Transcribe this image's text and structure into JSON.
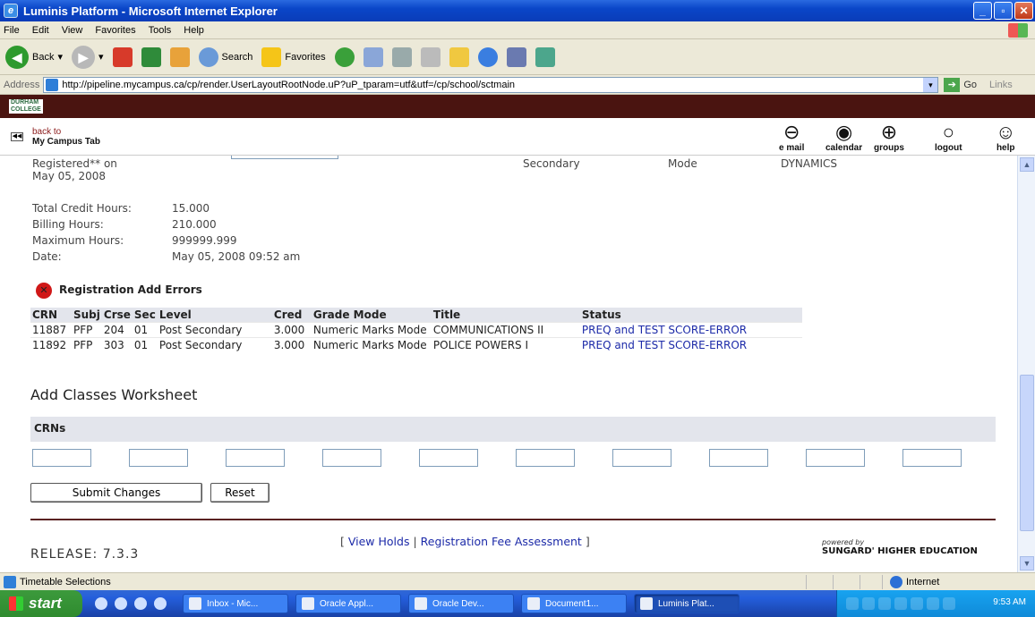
{
  "window": {
    "title": "Luminis Platform - Microsoft Internet Explorer"
  },
  "menu": [
    "File",
    "Edit",
    "View",
    "Favorites",
    "Tools",
    "Help"
  ],
  "toolbar": {
    "back": "Back",
    "search": "Search",
    "favorites": "Favorites"
  },
  "address": {
    "label": "Address",
    "url": "http://pipeline.mycampus.ca/cp/render.UserLayoutRootNode.uP?uP_tparam=utf&utf=/cp/school/sctmain",
    "go": "Go",
    "links": "Links"
  },
  "banner": {
    "logo_line1": "DURHAM",
    "logo_line2": "COLLEGE"
  },
  "nav": {
    "back_line1": "back to",
    "back_line2": "My Campus Tab",
    "icons": [
      {
        "label": "e mail",
        "glyph": "⊖"
      },
      {
        "label": "calendar",
        "glyph": "◉"
      },
      {
        "label": "groups",
        "glyph": "⊕"
      },
      {
        "label": "logout",
        "glyph": "○"
      },
      {
        "label": "help",
        "glyph": "☺"
      }
    ]
  },
  "top": {
    "registered": "Registered** on",
    "registered_date": "May 05, 2008",
    "secondary": "Secondary",
    "mode": "Mode",
    "dynamics": "DYNAMICS"
  },
  "summary": [
    {
      "label": "Total Credit Hours:",
      "value": "15.000"
    },
    {
      "label": "Billing Hours:",
      "value": "210.000"
    },
    {
      "label": "Maximum Hours:",
      "value": "999999.999"
    },
    {
      "label": "Date:",
      "value": "May 05, 2008 09:52 am"
    }
  ],
  "errors": {
    "heading": "Registration Add Errors",
    "columns": [
      "CRN",
      "Subj",
      "Crse",
      "Sec",
      "Level",
      "Cred",
      "Grade Mode",
      "Title",
      "Status"
    ],
    "rows": [
      [
        "11887",
        "PFP",
        "204",
        "01",
        "Post Secondary",
        "3.000",
        "Numeric Marks Mode",
        "COMMUNICATIONS II",
        "PREQ and TEST SCORE-ERROR"
      ],
      [
        "11892",
        "PFP",
        "303",
        "01",
        "Post Secondary",
        "3.000",
        "Numeric Marks Mode",
        "POLICE POWERS I",
        "PREQ and TEST SCORE-ERROR"
      ]
    ]
  },
  "worksheet": {
    "heading": "Add Classes Worksheet",
    "crns_label": "CRNs",
    "inputs": [
      "",
      "",
      "",
      "",
      "",
      "",
      "",
      "",
      "",
      ""
    ],
    "submit": "Submit Changes",
    "reset": "Reset"
  },
  "footer": {
    "view_holds": "View Holds",
    "fee": "Registration Fee Assessment",
    "release": "RELEASE: 7.3.3",
    "powered": "powered by",
    "sungard": "SUNGARD' HIGHER EDUCATION"
  },
  "status": {
    "text": "Timetable Selections",
    "zone": "Internet"
  },
  "taskbar": {
    "start": "start",
    "tasks": [
      "Inbox - Mic...",
      "Oracle Appl...",
      "Oracle Dev...",
      "Document1...",
      "Luminis Plat..."
    ],
    "clock": "9:53 AM"
  }
}
